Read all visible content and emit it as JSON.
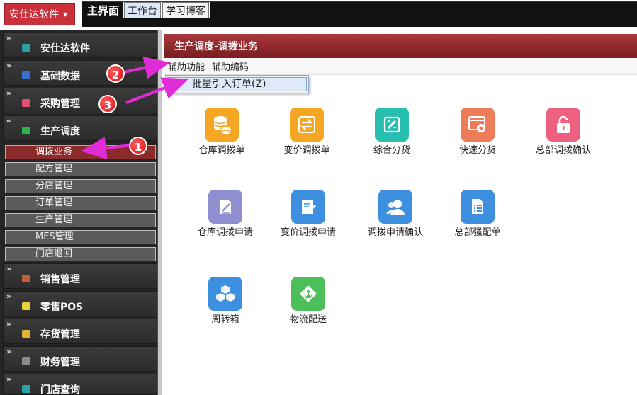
{
  "topbar": {
    "app_button": "安仕达软件",
    "tabs": [
      {
        "label": "主界面"
      },
      {
        "label": "工作台"
      },
      {
        "label": "学习博客"
      }
    ]
  },
  "sidebar": {
    "groups": [
      {
        "label": "安仕达软件",
        "icon": "cube-icon",
        "color": "#2aa0a8"
      },
      {
        "label": "基础数据",
        "icon": "database-icon",
        "color": "#3a6fd0"
      },
      {
        "label": "采购管理",
        "icon": "cart-icon",
        "color": "#e0506a"
      },
      {
        "label": "生产调度",
        "icon": "factory-icon",
        "color": "#2fb34a"
      },
      {
        "label": "销售管理",
        "icon": "sales-icon",
        "color": "#c0603a"
      },
      {
        "label": "零售POS",
        "icon": "pos-icon",
        "color": "#e8d23a"
      },
      {
        "label": "存货管理",
        "icon": "inventory-icon",
        "color": "#e0b23a"
      },
      {
        "label": "财务管理",
        "icon": "finance-icon",
        "color": "#8a8a8a"
      },
      {
        "label": "门店查询",
        "icon": "store-icon",
        "color": "#2aa0a8"
      }
    ],
    "sub_items": [
      {
        "label": "调拨业务"
      },
      {
        "label": "配方管理"
      },
      {
        "label": "分店管理"
      },
      {
        "label": "订单管理"
      },
      {
        "label": "生产管理"
      },
      {
        "label": "MES管理"
      },
      {
        "label": "门店退回"
      }
    ]
  },
  "main": {
    "header": "生产调度-调拨业务",
    "menu": [
      "辅助功能",
      "辅助编码"
    ],
    "dropdown_option": "批量引入订单(Z)",
    "tiles": [
      {
        "label": "仓库调拨单",
        "icon": "coins-icon",
        "color": "#f5a623"
      },
      {
        "label": "变价调拨单",
        "icon": "exchange-icon",
        "color": "#f5a623"
      },
      {
        "label": "综合分货",
        "icon": "edit-board-icon",
        "color": "#26bfb0"
      },
      {
        "label": "快速分货",
        "icon": "gear-window-icon",
        "color": "#ee7b5a"
      },
      {
        "label": "总部调拨确认",
        "icon": "lock-icon",
        "color": "#ee6080"
      },
      {
        "label": "仓库调拨申请",
        "icon": "document-pen-icon",
        "color": "#8f8fd0"
      },
      {
        "label": "变价调拨申请",
        "icon": "form-pen-icon",
        "color": "#3d8fe0"
      },
      {
        "label": "调拨申请确认",
        "icon": "users-icon",
        "color": "#3d8fe0"
      },
      {
        "label": "总部强配单",
        "icon": "list-doc-icon",
        "color": "#3d8fe0"
      },
      {
        "label": "周转箱",
        "icon": "boxes-icon",
        "color": "#3d8fe0"
      },
      {
        "label": "物流配送",
        "icon": "recycle-icon",
        "color": "#4cbf5a"
      }
    ]
  },
  "annotations": {
    "badges": [
      "1",
      "2",
      "3"
    ],
    "color": "#e02bd8"
  }
}
